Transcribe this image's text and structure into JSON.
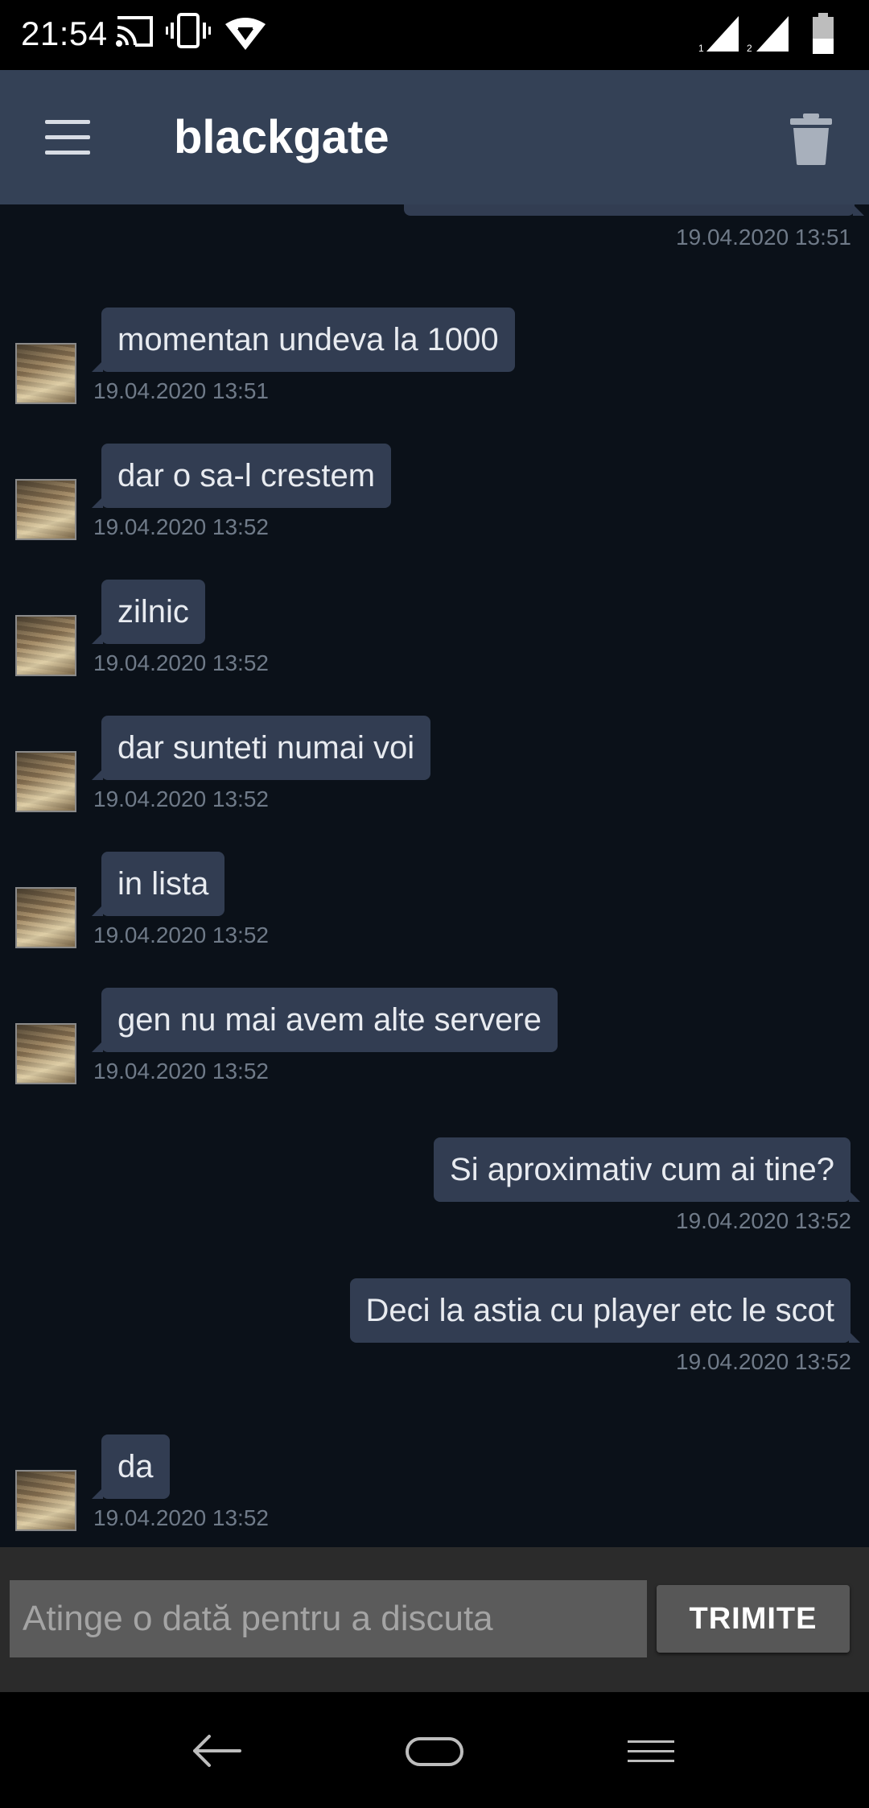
{
  "status_bar": {
    "time": "21:54",
    "icons": [
      "cast-icon",
      "vibrate-icon",
      "vpn-icon",
      "signal-sim1-icon",
      "signal-sim2-icon",
      "battery-icon"
    ],
    "sim1_label": "1",
    "sim2_label": "2"
  },
  "app_bar": {
    "title": "blackgate",
    "menu_icon": "menu-icon",
    "delete_icon": "trash-icon"
  },
  "messages": [
    {
      "side": "out",
      "text": "",
      "time": "19.04.2020 13:51"
    },
    {
      "side": "in",
      "text": "momentan undeva la 1000",
      "time": "19.04.2020 13:51"
    },
    {
      "side": "in",
      "text": "dar o sa-l crestem",
      "time": "19.04.2020 13:52"
    },
    {
      "side": "in",
      "text": "zilnic",
      "time": "19.04.2020 13:52"
    },
    {
      "side": "in",
      "text": "dar sunteti numai voi",
      "time": "19.04.2020 13:52"
    },
    {
      "side": "in",
      "text": "in lista",
      "time": "19.04.2020 13:52"
    },
    {
      "side": "in",
      "text": "gen nu mai avem alte servere",
      "time": "19.04.2020 13:52"
    },
    {
      "side": "out",
      "text": "Si aproximativ cum ai tine?",
      "time": "19.04.2020 13:52"
    },
    {
      "side": "out",
      "text": "Deci la astia cu player etc le scot",
      "time": "19.04.2020 13:52"
    },
    {
      "side": "in",
      "text": "da",
      "time": "19.04.2020 13:52"
    }
  ],
  "composer": {
    "placeholder": "Atinge o dată pentru a discuta",
    "send_label": "TRIMITE"
  },
  "nav_bar": {
    "icons": [
      "back-icon",
      "home-icon",
      "menu-lines-icon"
    ]
  },
  "colors": {
    "chat_bg": "#0b1119",
    "app_bar": "#344156",
    "bubble": "#323d52",
    "timestamp": "#6f7a88"
  }
}
